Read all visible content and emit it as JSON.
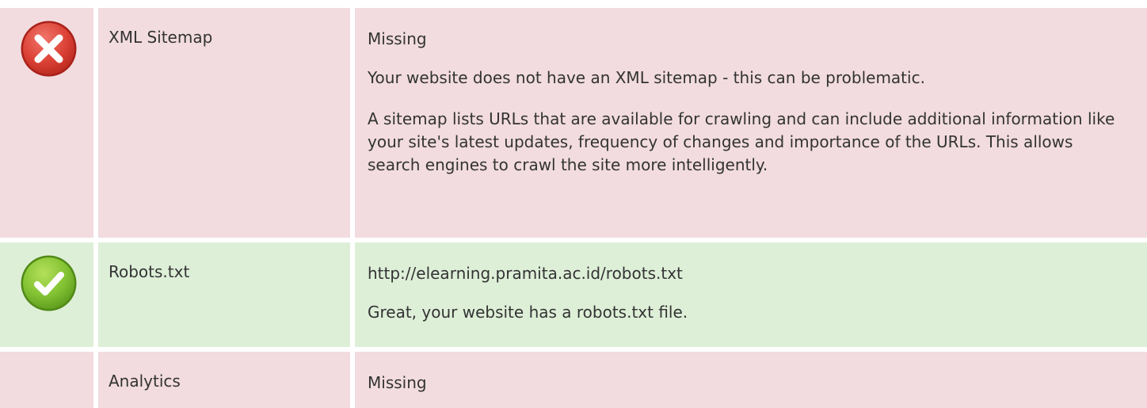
{
  "rows": [
    {
      "status": "error",
      "status_icon": "error-x-icon",
      "name": "XML Sitemap",
      "details": [
        "Missing",
        "Your website does not have an XML sitemap - this can be problematic.",
        "A sitemap lists URLs that are available for crawling and can include additional information like your site's latest updates, frequency of changes and importance of the URLs. This allows search engines to crawl the site more intelligently."
      ]
    },
    {
      "status": "pass",
      "status_icon": "check-icon",
      "name": "Robots.txt",
      "details": [
        "http://elearning.pramita.ac.id/robots.txt",
        "Great, your website has a robots.txt file."
      ]
    },
    {
      "status": "error",
      "status_icon": "",
      "name": "Analytics",
      "details": [
        "Missing"
      ]
    }
  ],
  "colors": {
    "error_bg": "#f2dcdf",
    "pass_bg": "#deefd8",
    "error_icon": "#d9443a",
    "pass_icon": "#7cbf2e"
  }
}
